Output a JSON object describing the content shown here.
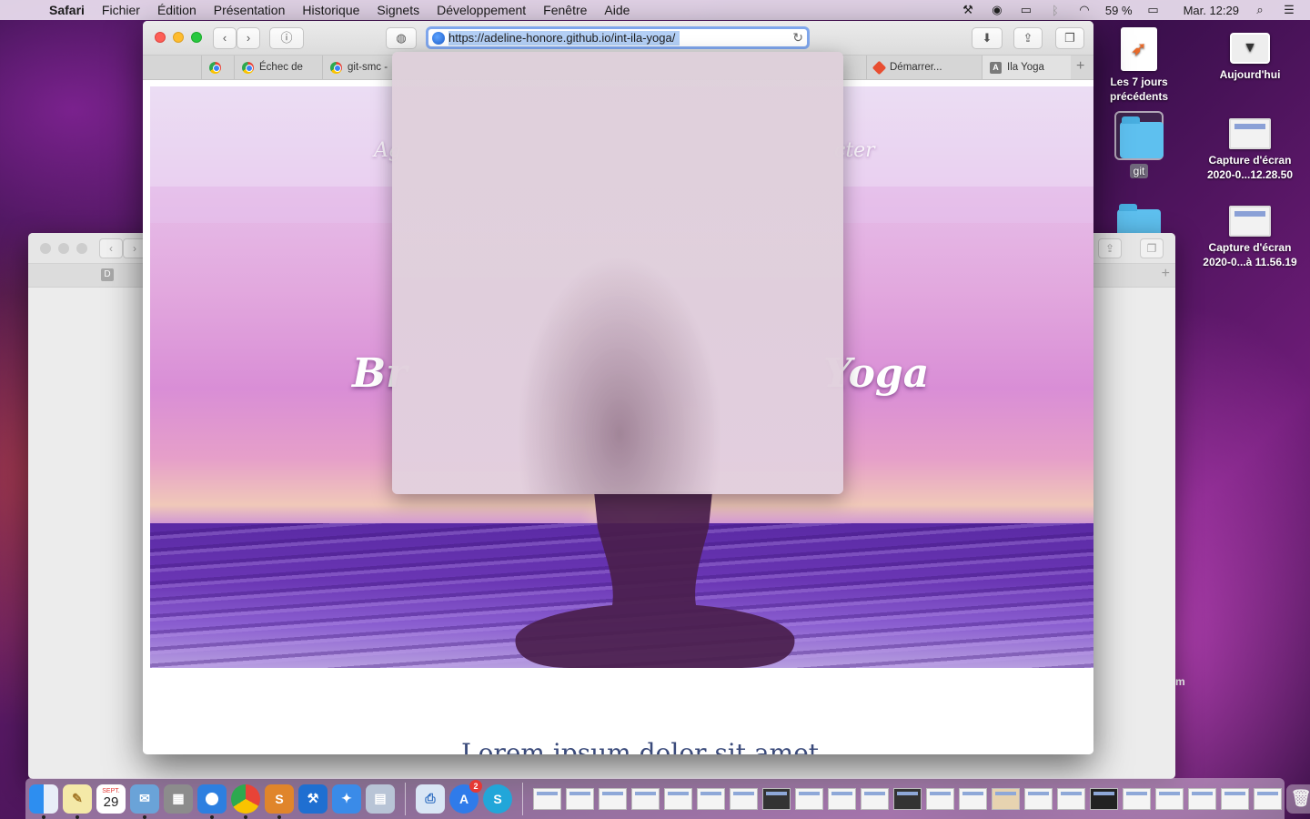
{
  "menubar": {
    "app_name": "Safari",
    "items": [
      "Fichier",
      "Édition",
      "Présentation",
      "Historique",
      "Signets",
      "Développement",
      "Fenêtre",
      "Aide"
    ],
    "battery": "59 %",
    "clock": "Mar. 12:29"
  },
  "desktop": {
    "items": [
      {
        "label": "Les 7 jours précédents",
        "icon": "playground-doc-icon"
      },
      {
        "label": "Aujourd'hui",
        "icon": "drive-icon"
      },
      {
        "label": "git",
        "icon": "folder-icon"
      },
      {
        "label": "Capture d'écran 2020-0...12.28.50",
        "icon": "screenshot-icon"
      },
      {
        "label": "Capture d'écran 2020-0...à 11.56.19",
        "icon": "screenshot-icon"
      }
    ],
    "partial_label": "m"
  },
  "background_window": {
    "tab_letter": "D"
  },
  "safari": {
    "url": "https://adeline-honore.github.io/int-ila-yoga/",
    "tabs": [
      {
        "label": "",
        "favicon": "chrome-icon"
      },
      {
        "label": "Échec de",
        "favicon": "chrome-icon"
      },
      {
        "label": "git-smc -",
        "favicon": "chrome-icon"
      },
      {
        "label": "Démarrer...",
        "favicon": "git-icon"
      },
      {
        "label": "Ila Yoga",
        "favicon": "a-icon"
      }
    ],
    "new_tab_symbol": "+"
  },
  "page": {
    "nav_left": "Ag",
    "nav_right": "cter",
    "hero_title_left": "Br",
    "hero_title_right": "Yoga",
    "section_heading": "Lorem ipsum dolor sit amet"
  },
  "dock": {
    "calendar_month": "SEPT.",
    "calendar_day": "29",
    "app_store_badge": "2"
  }
}
